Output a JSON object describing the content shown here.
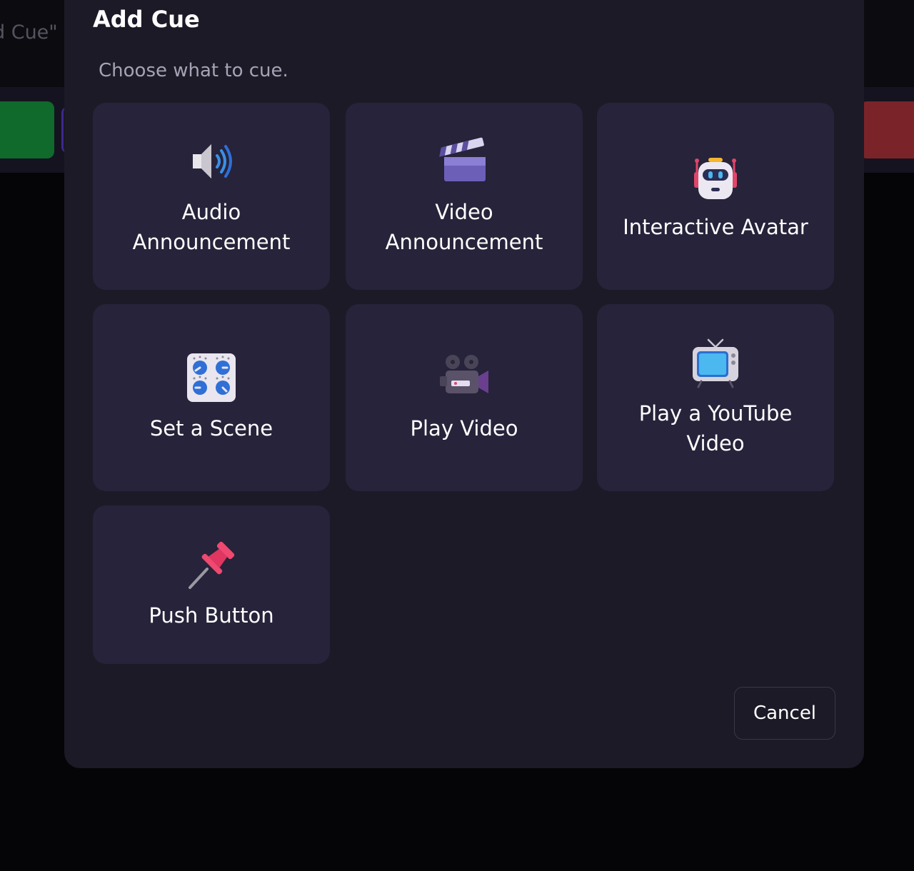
{
  "background": {
    "title_fragment": "d Cue\""
  },
  "dialog": {
    "title": "Add Cue",
    "subtitle": "Choose what to cue.",
    "cancel_label": "Cancel",
    "options": [
      {
        "label": "Audio Announcement",
        "icon": "speaker-icon"
      },
      {
        "label": "Video Announcement",
        "icon": "clapper-board-icon"
      },
      {
        "label": "Interactive Avatar",
        "icon": "robot-icon"
      },
      {
        "label": "Set a Scene",
        "icon": "control-knobs-icon"
      },
      {
        "label": "Play Video",
        "icon": "movie-camera-icon"
      },
      {
        "label": "Play a YouTube Video",
        "icon": "television-icon"
      },
      {
        "label": "Push Button",
        "icon": "pushpin-icon"
      }
    ]
  },
  "colors": {
    "modal_bg": "#1c1a27",
    "card_bg": "#26233a",
    "page_bg": "#08080c",
    "accent_green": "#0f6a2c",
    "accent_red": "#7a2329"
  }
}
